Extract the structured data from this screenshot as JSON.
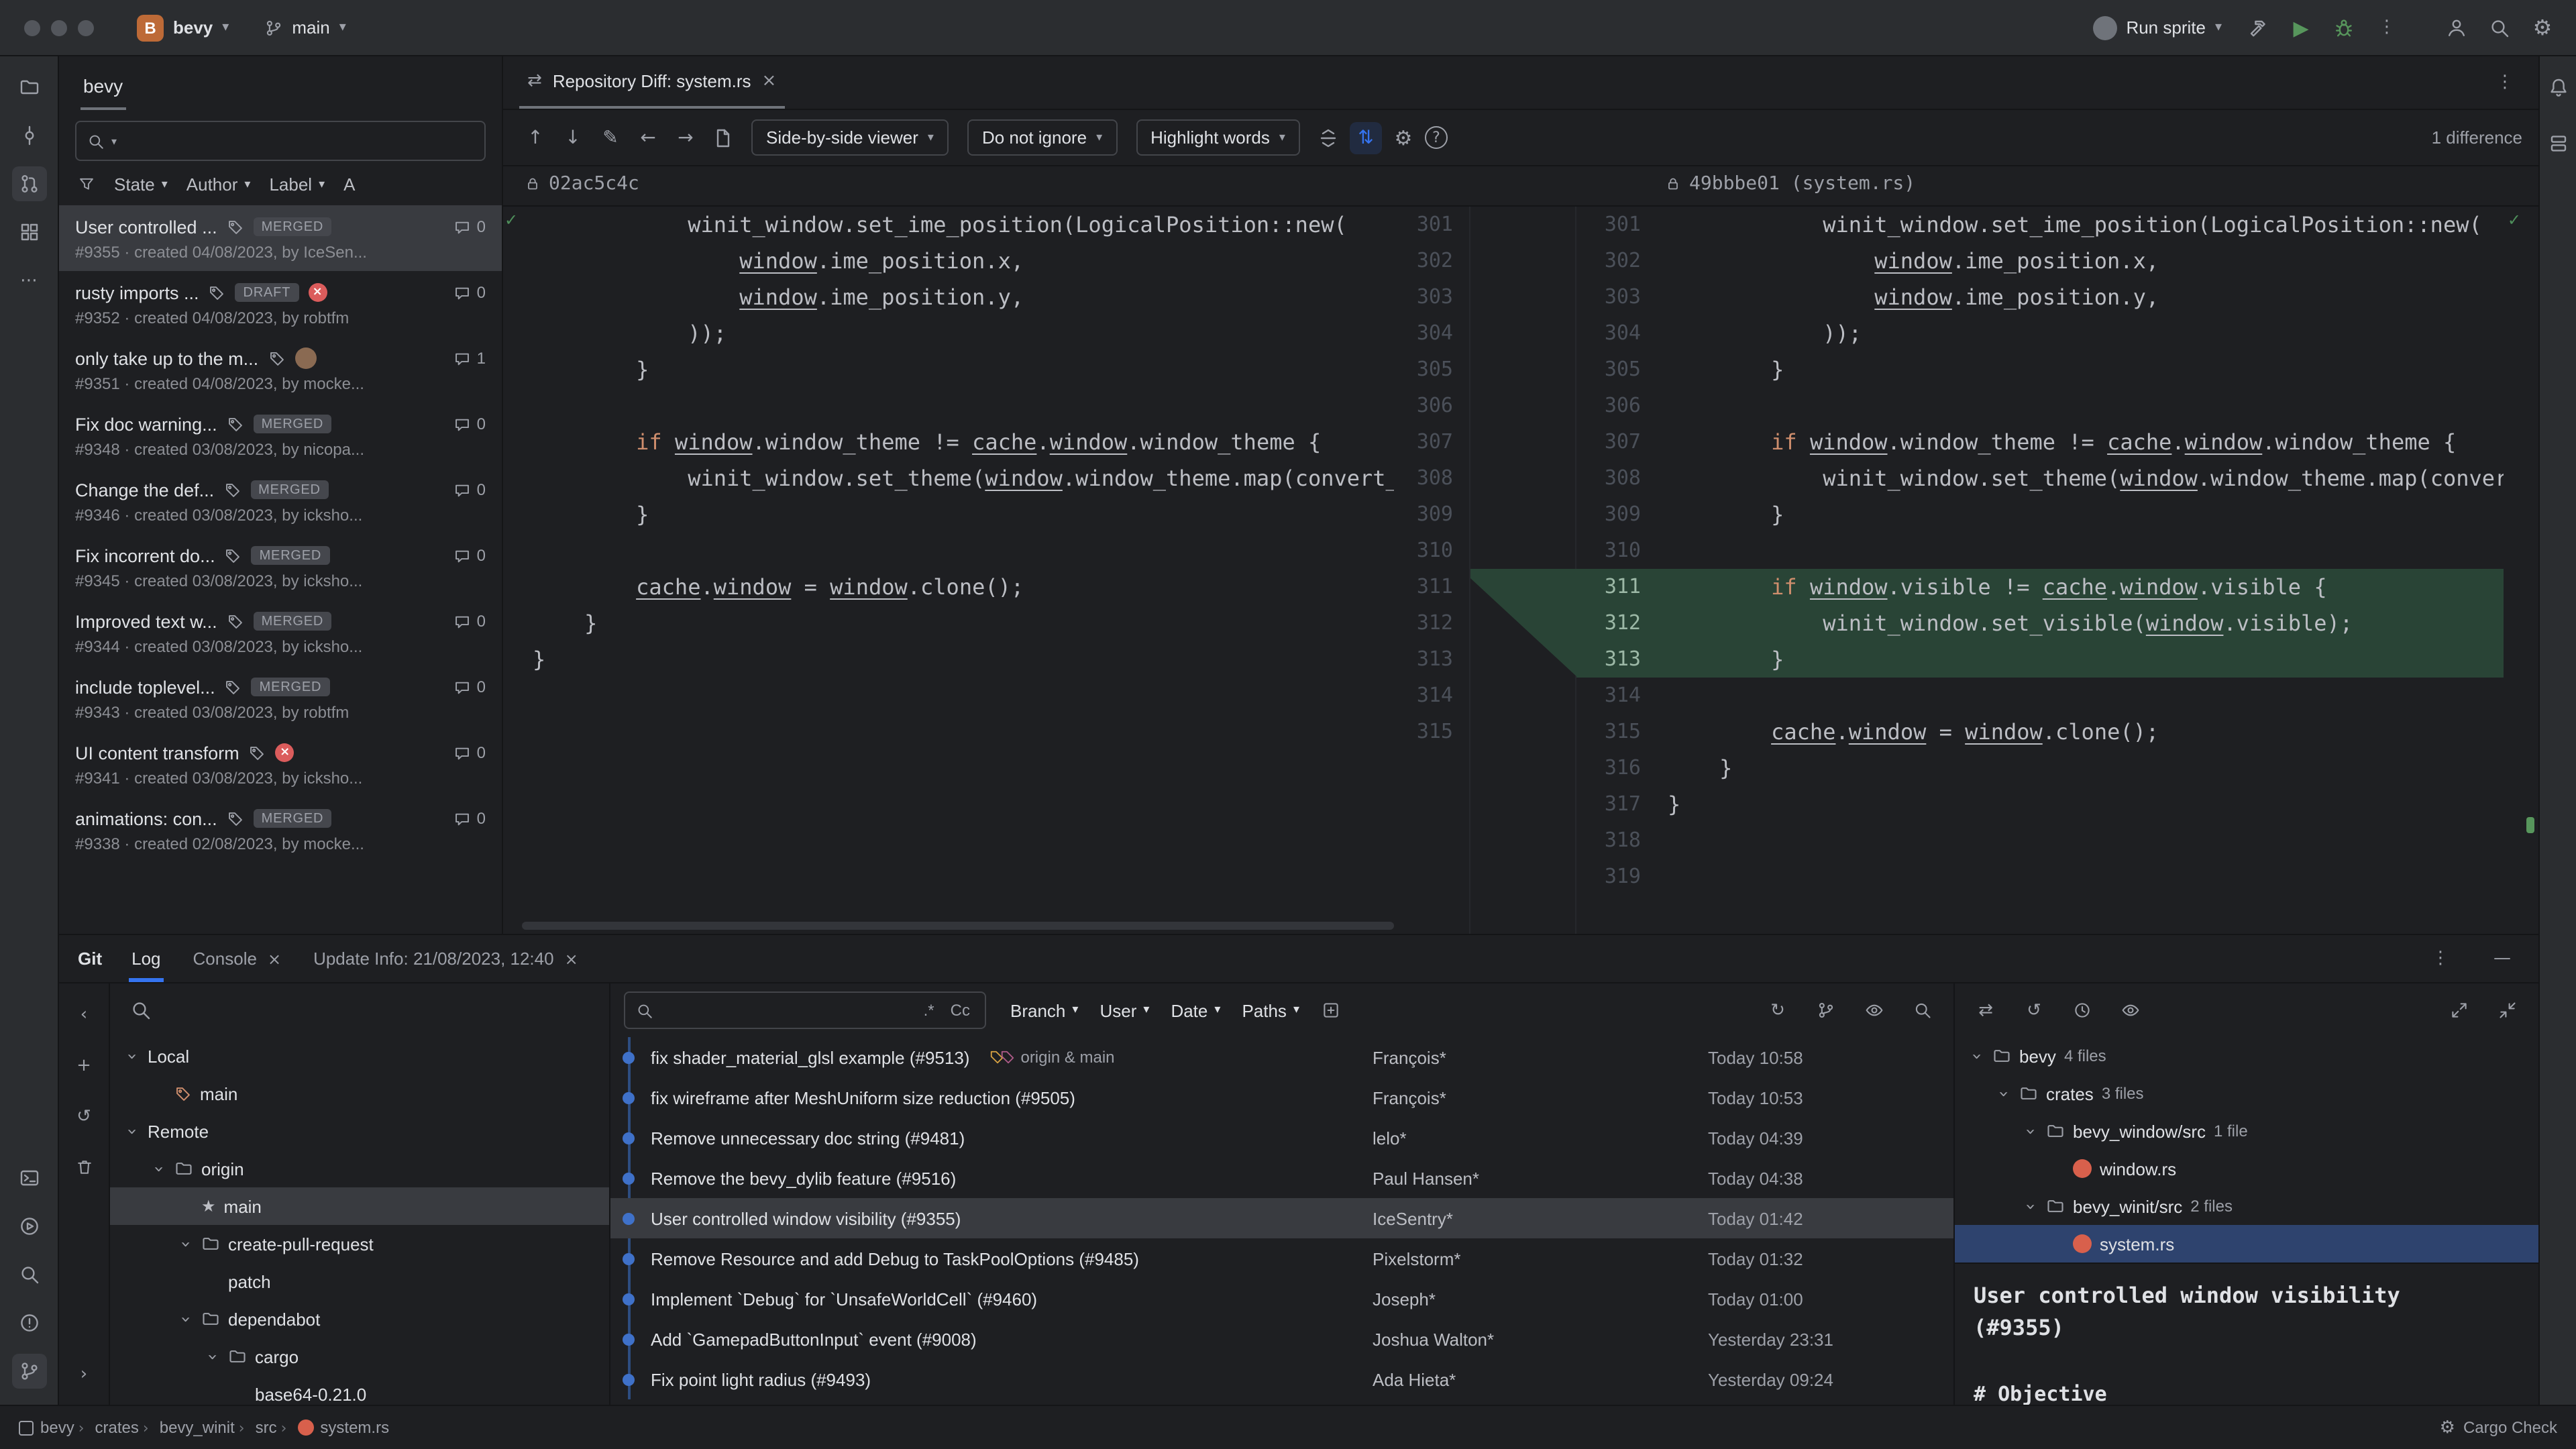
{
  "glyphs": {
    "chevron_down": "▾",
    "chevron_right": "›",
    "chevron_left": "‹",
    "tree_chevron": "›",
    "more_v": "⋮",
    "more_h": "⋯",
    "close": "×",
    "check": "✓",
    "arrow_up": "↑",
    "arrow_down": "↓",
    "arrow_left": "←",
    "arrow_right": "→",
    "pencil": "✎",
    "gear": "⚙",
    "play": "▶",
    "refresh": "↻",
    "undo": "↺",
    "compare": "⇄",
    "sync_scroll": "⇅",
    "star": "★",
    "plus": "+",
    "minimize": "—",
    "help": "?"
  },
  "titlebar": {
    "project_initial": "B",
    "project": "bevy",
    "branch": "main",
    "run_config": "Run sprite"
  },
  "pr_panel": {
    "title": "bevy",
    "filters": [
      {
        "label": "State",
        "chevron": true
      },
      {
        "label": "Author",
        "chevron": true
      },
      {
        "label": "Label",
        "chevron": true
      },
      {
        "label": "A",
        "chevron": false
      }
    ],
    "items": [
      {
        "title": "User controlled ...",
        "badge": "MERGED",
        "declined": false,
        "avatar": false,
        "comments": "0",
        "meta": "#9355 · created 04/08/2023, by IceSen...",
        "selected": true
      },
      {
        "title": "rusty imports ...",
        "badge": "DRAFT",
        "declined": true,
        "avatar": false,
        "comments": "0",
        "meta": "#9352 · created 04/08/2023, by robtfm"
      },
      {
        "title": "only take up to the m...",
        "badge": "",
        "declined": false,
        "avatar": true,
        "comments": "1",
        "meta": "#9351 · created 04/08/2023, by mocke..."
      },
      {
        "title": "Fix doc warning...",
        "badge": "MERGED",
        "declined": false,
        "avatar": false,
        "comments": "0",
        "meta": "#9348 · created 03/08/2023, by nicopa..."
      },
      {
        "title": "Change the def...",
        "badge": "MERGED",
        "declined": false,
        "avatar": false,
        "comments": "0",
        "meta": "#9346 · created 03/08/2023, by icksho..."
      },
      {
        "title": "Fix incorrent do...",
        "badge": "MERGED",
        "declined": false,
        "avatar": false,
        "comments": "0",
        "meta": "#9345 · created 03/08/2023, by icksho..."
      },
      {
        "title": "Improved text w...",
        "badge": "MERGED",
        "declined": false,
        "avatar": false,
        "comments": "0",
        "meta": "#9344 · created 03/08/2023, by icksho..."
      },
      {
        "title": "include toplevel...",
        "badge": "MERGED",
        "declined": false,
        "avatar": false,
        "comments": "0",
        "meta": "#9343 · created 03/08/2023, by robtfm"
      },
      {
        "title": "UI content transform",
        "badge": "",
        "declined": true,
        "avatar": false,
        "comments": "0",
        "meta": "#9341 · created 03/08/2023, by icksho..."
      },
      {
        "title": "animations: con...",
        "badge": "MERGED",
        "declined": false,
        "avatar": false,
        "comments": "0",
        "meta": "#9338 · created 02/08/2023, by mocke..."
      }
    ]
  },
  "editor": {
    "tab_title": "Repository Diff: system.rs",
    "toolbar": {
      "viewer": "Side-by-side viewer",
      "ignore": "Do not ignore",
      "highlight": "Highlight words",
      "diff_count": "1 difference"
    },
    "left_commit": "02ac5c4c",
    "right_commit": "49bbbe01 (system.rs)",
    "left_lines": [
      {
        "num": 301,
        "text": "            winit_window.set_ime_position(LogicalPosition::new("
      },
      {
        "num": 302,
        "text": "                window.ime_position.x,"
      },
      {
        "num": 303,
        "text": "                window.ime_position.y,"
      },
      {
        "num": 304,
        "text": "            ));"
      },
      {
        "num": 305,
        "text": "        }"
      },
      {
        "num": 306,
        "text": ""
      },
      {
        "num": 307,
        "text": "        if window.window_theme != cache.window.window_theme {"
      },
      {
        "num": 308,
        "text": "            winit_window.set_theme(window.window_theme.map(convert_window_theme));"
      },
      {
        "num": 309,
        "text": "        }"
      },
      {
        "num": 310,
        "text": ""
      },
      {
        "num": 311,
        "text": "        cache.window = window.clone();"
      },
      {
        "num": 312,
        "text": "    }"
      },
      {
        "num": 313,
        "text": "}"
      },
      {
        "num": 314,
        "text": ""
      },
      {
        "num": 315,
        "text": ""
      }
    ],
    "right_lines": [
      {
        "num": 301,
        "text": "            winit_window.set_ime_position(LogicalPosition::new("
      },
      {
        "num": 302,
        "text": "                window.ime_position.x,"
      },
      {
        "num": 303,
        "text": "                window.ime_position.y,"
      },
      {
        "num": 304,
        "text": "            ));"
      },
      {
        "num": 305,
        "text": "        }"
      },
      {
        "num": 306,
        "text": ""
      },
      {
        "num": 307,
        "text": "        if window.window_theme != cache.window.window_theme {"
      },
      {
        "num": 308,
        "text": "            winit_window.set_theme(window.window_theme.map(convert_window_theme));"
      },
      {
        "num": 309,
        "text": "        }"
      },
      {
        "num": 310,
        "text": ""
      },
      {
        "num": 311,
        "text": "        if window.visible != cache.window.visible {",
        "added": true
      },
      {
        "num": 312,
        "text": "            winit_window.set_visible(window.visible);",
        "added": true
      },
      {
        "num": 313,
        "text": "        }",
        "added": true
      },
      {
        "num": 314,
        "text": ""
      },
      {
        "num": 315,
        "text": "        cache.window = window.clone();"
      },
      {
        "num": 316,
        "text": "    }"
      },
      {
        "num": 317,
        "text": "}"
      },
      {
        "num": 318,
        "text": ""
      },
      {
        "num": 319,
        "text": ""
      }
    ]
  },
  "git_panel": {
    "title": "Git",
    "log_tab": "Log",
    "console_tab": "Console",
    "update_tab": "Update Info: 21/08/2023, 12:40",
    "branches": [
      {
        "label": "Local",
        "level": 0,
        "chevron": true
      },
      {
        "label": "main",
        "level": 1,
        "tag": true
      },
      {
        "label": "Remote",
        "level": 0,
        "chevron": true
      },
      {
        "label": "origin",
        "level": 1,
        "chevron": true,
        "folder": true
      },
      {
        "label": "main",
        "level": 2,
        "star": true,
        "selected": true
      },
      {
        "label": "create-pull-request",
        "level": 2,
        "chevron": true,
        "folder": true
      },
      {
        "label": "patch",
        "level": 3
      },
      {
        "label": "dependabot",
        "level": 2,
        "chevron": true,
        "folder": true
      },
      {
        "label": "cargo",
        "level": 3,
        "chevron": true,
        "folder": true
      },
      {
        "label": "base64-0.21.0",
        "level": 4
      }
    ],
    "log": {
      "regex_toggle": ".*",
      "case_toggle": "Cc",
      "filters": [
        {
          "label": "Branch",
          "chevron": true
        },
        {
          "label": "User",
          "chevron": true
        },
        {
          "label": "Date",
          "chevron": true
        },
        {
          "label": "Paths",
          "chevron": true
        }
      ],
      "rows": [
        {
          "msg": "fix shader_material_glsl example (#9513)",
          "tags": "origin & main",
          "author": "François*",
          "date": "Today 10:58"
        },
        {
          "msg": "fix wireframe after MeshUniform size reduction (#9505)",
          "author": "François*",
          "date": "Today 10:53"
        },
        {
          "msg": "Remove unnecessary doc string (#9481)",
          "author": "lelo*",
          "date": "Today 04:39"
        },
        {
          "msg": "Remove the bevy_dylib feature (#9516)",
          "author": "Paul Hansen*",
          "date": "Today 04:38"
        },
        {
          "msg": "User controlled window visibility (#9355)",
          "author": "IceSentry*",
          "date": "Today 01:42",
          "selected": true
        },
        {
          "msg": "Remove Resource and add Debug to TaskPoolOptions (#9485)",
          "author": "Pixelstorm*",
          "date": "Today 01:32"
        },
        {
          "msg": "Implement `Debug` for `UnsafeWorldCell` (#9460)",
          "author": "Joseph*",
          "date": "Today 01:00"
        },
        {
          "msg": "Add `GamepadButtonInput` event (#9008)",
          "author": "Joshua Walton*",
          "date": "Yesterday 23:31"
        },
        {
          "msg": "Fix point light radius (#9493)",
          "author": "Ada Hieta*",
          "date": "Yesterday 09:24"
        }
      ]
    },
    "files": [
      {
        "label": "bevy",
        "suffix": "4 files",
        "level": 0,
        "chevron": true,
        "folder": true
      },
      {
        "label": "crates",
        "suffix": "3 files",
        "level": 1,
        "chevron": true,
        "folder": true
      },
      {
        "label": "bevy_window/src",
        "suffix": "1 file",
        "level": 2,
        "chevron": true,
        "folder": true
      },
      {
        "label": "window.rs",
        "suffix": "",
        "level": 3,
        "rust": true
      },
      {
        "label": "bevy_winit/src",
        "suffix": "2 files",
        "level": 2,
        "chevron": true,
        "folder": true
      },
      {
        "label": "system.rs",
        "suffix": "",
        "level": 3,
        "rust": true,
        "selected": true
      }
    ],
    "details": {
      "title": "User controlled window visibility (#9355)",
      "body": "# Objective"
    }
  },
  "status_bar": {
    "breadcrumbs": [
      {
        "label": "bevy",
        "project_icon": true
      },
      {
        "label": "crates",
        "sep": true
      },
      {
        "label": "bevy_winit",
        "sep": true
      },
      {
        "label": "src",
        "sep": true
      },
      {
        "label": "system.rs",
        "sep": true,
        "rust": true
      }
    ],
    "right": "Cargo Check"
  }
}
